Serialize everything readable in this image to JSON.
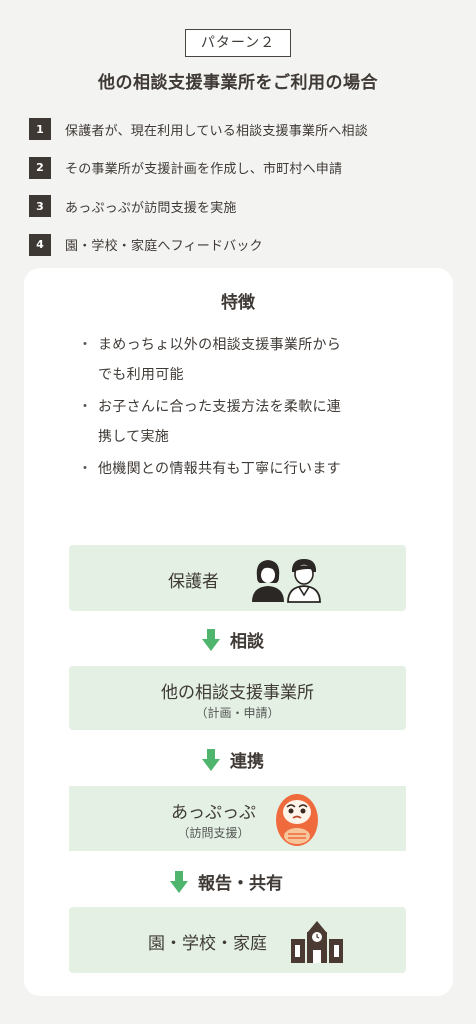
{
  "pattern_label": "パターン２",
  "main_title": "他の相談支援事業所をご利用の場合",
  "steps": [
    {
      "num": "1",
      "text": "保護者が、現在利用している相談支援事業所へ相談"
    },
    {
      "num": "2",
      "text": "その事業所が支援計画を作成し、市町村へ申請"
    },
    {
      "num": "3",
      "text": "あっぷっぷが訪問支援を実施"
    },
    {
      "num": "4",
      "text": "園・学校・家庭へフィードバック"
    }
  ],
  "features": {
    "title": "特徴",
    "items": [
      {
        "bullet": "・",
        "line1": "まめっちょ以外の相談支援事業所から",
        "line2": "でも利用可能"
      },
      {
        "bullet": "・",
        "line1": "お子さんに合った支援方法を柔軟に連",
        "line2": "携して実施"
      },
      {
        "bullet": "・",
        "line1": "他機関との情報共有も丁寧に行います",
        "line2": ""
      }
    ]
  },
  "flow": {
    "guardian": {
      "label": "保護者",
      "icon": "parents-icon"
    },
    "arrow1": "相談",
    "office": {
      "label": "他の相談支援事業所",
      "sub": "（計画・申請）"
    },
    "arrow2": "連携",
    "appuppu": {
      "label": "あっぷっぷ",
      "sub": "（訪問支援）",
      "icon": "daruma-icon"
    },
    "arrow3": "報告・共有",
    "school": {
      "label": "園・学校・家庭",
      "icon": "school-building-icon"
    }
  },
  "colors": {
    "background": "#f3f3f1",
    "card": "#ffffff",
    "box": "#e3f0e3",
    "arrow": "#4fb56d",
    "dark": "#3d3834",
    "daruma": "#ef6a3c"
  }
}
